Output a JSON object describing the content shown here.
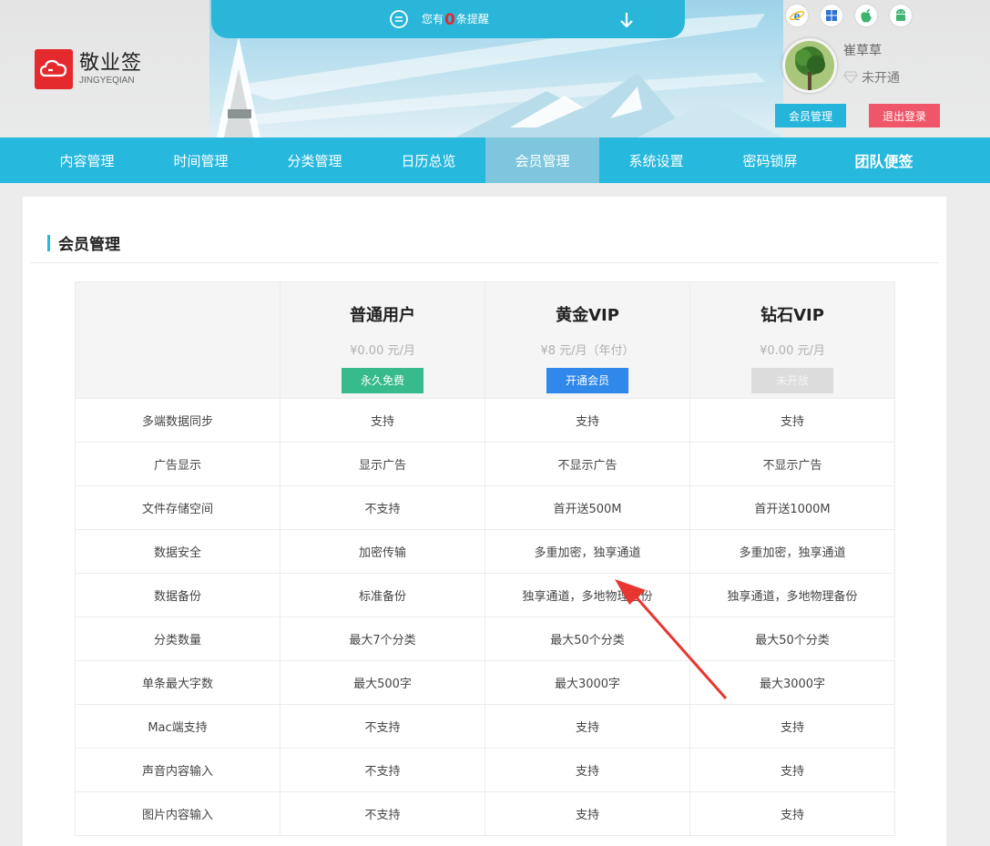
{
  "logo": {
    "name_cn": "敬业签",
    "name_en": "JINGYEQIAN"
  },
  "notice": {
    "prefix": "您有",
    "count": "0",
    "suffix": "条提醒"
  },
  "platforms": [
    "ie-icon",
    "windows-icon",
    "apple-icon",
    "android-icon"
  ],
  "user": {
    "name": "崔草草",
    "status": "未开通",
    "member_button": "会员管理",
    "logout_button": "退出登录"
  },
  "nav": {
    "items": [
      {
        "label": "内容管理"
      },
      {
        "label": "时间管理"
      },
      {
        "label": "分类管理"
      },
      {
        "label": "日历总览"
      },
      {
        "label": "会员管理"
      },
      {
        "label": "系统设置"
      },
      {
        "label": "密码锁屏"
      },
      {
        "label": "团队便签"
      }
    ],
    "active_index": 4
  },
  "page": {
    "title": "会员管理"
  },
  "tiers": [
    {
      "name": "普通用户",
      "price": "¥0.00 元/月",
      "button": "永久免费"
    },
    {
      "name": "黄金VIP",
      "price": "¥8 元/月（年付）",
      "button": "开通会员"
    },
    {
      "name": "钻石VIP",
      "price": "¥0.00 元/月",
      "button": "未开放"
    }
  ],
  "features": [
    {
      "name": "多端数据同步",
      "values": [
        "支持",
        "支持",
        "支持"
      ]
    },
    {
      "name": "广告显示",
      "values": [
        "显示广告",
        "不显示广告",
        "不显示广告"
      ]
    },
    {
      "name": "文件存储空间",
      "values": [
        "不支持",
        "首开送500M",
        "首开送1000M"
      ]
    },
    {
      "name": "数据安全",
      "values": [
        "加密传输",
        "多重加密，独享通道",
        "多重加密，独享通道"
      ]
    },
    {
      "name": "数据备份",
      "values": [
        "标准备份",
        "独享通道，多地物理备份",
        "独享通道，多地物理备份"
      ]
    },
    {
      "name": "分类数量",
      "values": [
        "最大7个分类",
        "最大50个分类",
        "最大50个分类"
      ]
    },
    {
      "name": "单条最大字数",
      "values": [
        "最大500字",
        "最大3000字",
        "最大3000字"
      ]
    },
    {
      "name": "Mac端支持",
      "values": [
        "不支持",
        "支持",
        "支持"
      ]
    },
    {
      "name": "声音内容输入",
      "values": [
        "不支持",
        "支持",
        "支持"
      ]
    },
    {
      "name": "图片内容输入",
      "values": [
        "不支持",
        "支持",
        "支持"
      ]
    }
  ],
  "colors": {
    "accent": "#27b8de",
    "logout": "#f0566a",
    "free": "#37bb8c",
    "open": "#2f88ea",
    "logo": "#e52a2e"
  }
}
